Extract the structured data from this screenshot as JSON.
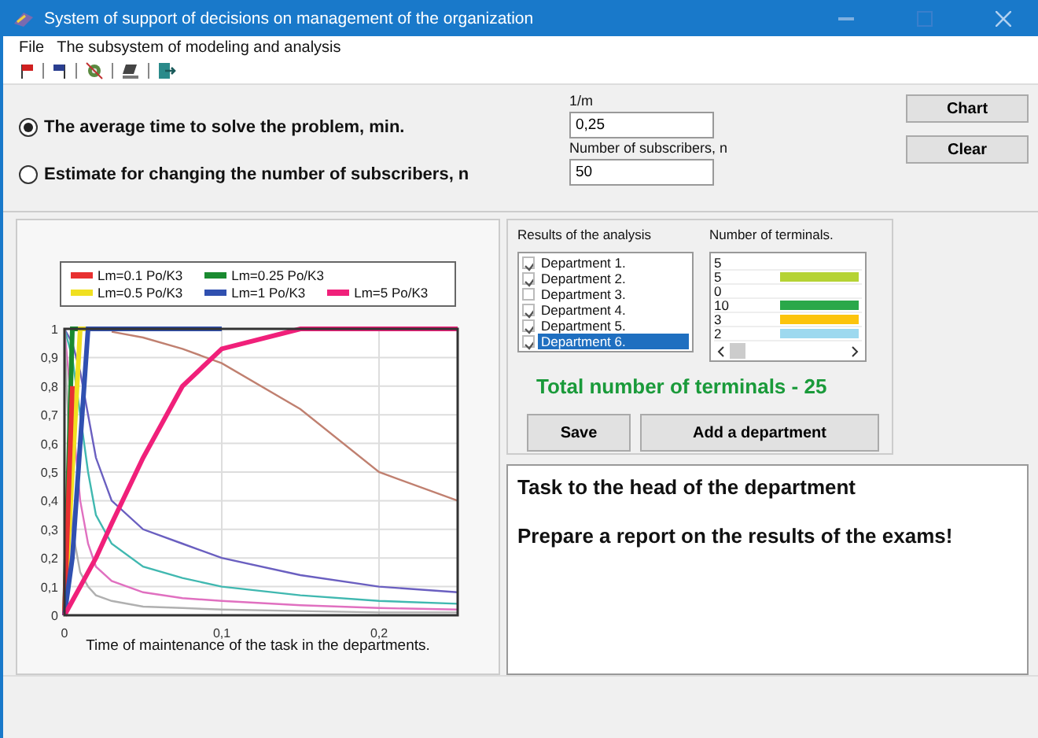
{
  "window": {
    "title": "System of support of decisions on management of the organization"
  },
  "menu": [
    "File",
    "The subsystem of modeling and analysis"
  ],
  "modes": [
    {
      "label": "The average time to solve the problem, min.",
      "selected": true
    },
    {
      "label": "Estimate for changing the number of subscribers, n",
      "selected": false
    }
  ],
  "fields": [
    {
      "label": "1/m",
      "value": "0,25"
    },
    {
      "label": "Number of subscribers, n",
      "value": "50"
    }
  ],
  "buttons": [
    "Chart",
    "Clear"
  ],
  "chart": {
    "chart_data": {
      "type": "line",
      "grid": true,
      "xlabel": "Time of maintenance of the task in the departments.",
      "x": [
        0,
        0.005,
        0.01,
        0.015,
        0.02,
        0.03,
        0.05,
        0.075,
        0.1,
        0.15,
        0.2,
        0.25
      ],
      "xlim": [
        0,
        0.25
      ],
      "ylim": [
        0,
        1
      ],
      "xticks": [
        0,
        {
          "value": 0.1,
          "label": "0,1"
        },
        {
          "value": 0.2,
          "label": "0,2"
        }
      ],
      "yticks": [
        0,
        {
          "value": 0.1,
          "label": "0,1"
        },
        {
          "value": 0.2,
          "label": "0,2"
        },
        {
          "value": 0.3,
          "label": "0,3"
        },
        {
          "value": 0.4,
          "label": "0,4"
        },
        {
          "value": 0.5,
          "label": "0,5"
        },
        {
          "value": 0.6,
          "label": "0,6"
        },
        {
          "value": 0.7,
          "label": "0,7"
        },
        {
          "value": 0.8,
          "label": "0,8"
        },
        {
          "value": 0.9,
          "label": "0,9"
        },
        1
      ],
      "series": [
        {
          "color": "#c08070",
          "values": [
            null,
            null,
            null,
            null,
            null,
            0.99,
            0.97,
            0.93,
            0.88,
            0.72,
            0.5,
            0.4
          ]
        },
        {
          "color": "#6a5fc0",
          "values": [
            1,
            0.95,
            0.85,
            0.7,
            0.55,
            0.4,
            0.3,
            0.25,
            0.2,
            0.14,
            0.1,
            0.08
          ]
        },
        {
          "color": "#40b8b0",
          "values": [
            1,
            0.9,
            0.7,
            0.5,
            0.35,
            0.25,
            0.17,
            0.13,
            0.1,
            0.07,
            0.05,
            0.04
          ]
        },
        {
          "color": "#e070c0",
          "values": [
            1,
            0.7,
            0.4,
            0.25,
            0.17,
            0.12,
            0.08,
            0.06,
            0.05,
            0.035,
            0.025,
            0.02
          ]
        },
        {
          "color": "#b0b0b0",
          "values": [
            1,
            0.3,
            0.15,
            0.1,
            0.07,
            0.05,
            0.03,
            0.025,
            0.02,
            0.015,
            0.01,
            0.01
          ]
        },
        {
          "name": "Lm=0.1 Po/K3",
          "color": "#e83030",
          "values": [
            0,
            0.8,
            null,
            null,
            null,
            null,
            null,
            null,
            null,
            null,
            null,
            null
          ]
        },
        {
          "name": "Lm=0.25 Po/K3",
          "color": "#1a8a30",
          "values": [
            0,
            1,
            1,
            null,
            null,
            null,
            null,
            null,
            null,
            null,
            null,
            null
          ]
        },
        {
          "name": "Lm=0.5 Po/K3",
          "color": "#f0e020",
          "values": [
            0,
            0.5,
            1,
            1,
            null,
            null,
            null,
            null,
            null,
            null,
            null,
            null
          ]
        },
        {
          "name": "Lm=1 Po/K3",
          "color": "#3050b0",
          "values": [
            0,
            0.2,
            0.6,
            1,
            1,
            1,
            1,
            1,
            1,
            null,
            null,
            null
          ]
        },
        {
          "name": "Lm=5 Po/K3",
          "color": "#f0207a",
          "values": [
            0,
            0.05,
            0.1,
            0.15,
            0.2,
            0.32,
            0.55,
            0.8,
            0.93,
            1,
            1,
            1
          ]
        }
      ]
    }
  },
  "analysis": {
    "title": "Results of the analysis",
    "departments": [
      {
        "label": "Department 1.",
        "checked": true,
        "selected": false
      },
      {
        "label": "Department 2.",
        "checked": true,
        "selected": false
      },
      {
        "label": "Department 3.",
        "checked": false,
        "selected": false
      },
      {
        "label": "Department 4.",
        "checked": true,
        "selected": false
      },
      {
        "label": "Department 5.",
        "checked": true,
        "selected": false
      },
      {
        "label": "Department 6.",
        "checked": true,
        "selected": true
      }
    ]
  },
  "terminals": {
    "title": "Number of terminals.",
    "rows": [
      {
        "count": "5"
      },
      {
        "count": "5",
        "color": "#b5d334"
      },
      {
        "count": "0"
      },
      {
        "count": "10",
        "color": "#2aa84a"
      },
      {
        "count": "3",
        "color": "#fcc40c"
      },
      {
        "count": "2",
        "color": "#9dd9ef"
      }
    ]
  },
  "total": "Total number of terminals  - 25",
  "actions": [
    "Save",
    "Add a department"
  ],
  "task": {
    "heading": "Task to the head of the department",
    "body": "Prepare a report on the results of the exams!"
  }
}
